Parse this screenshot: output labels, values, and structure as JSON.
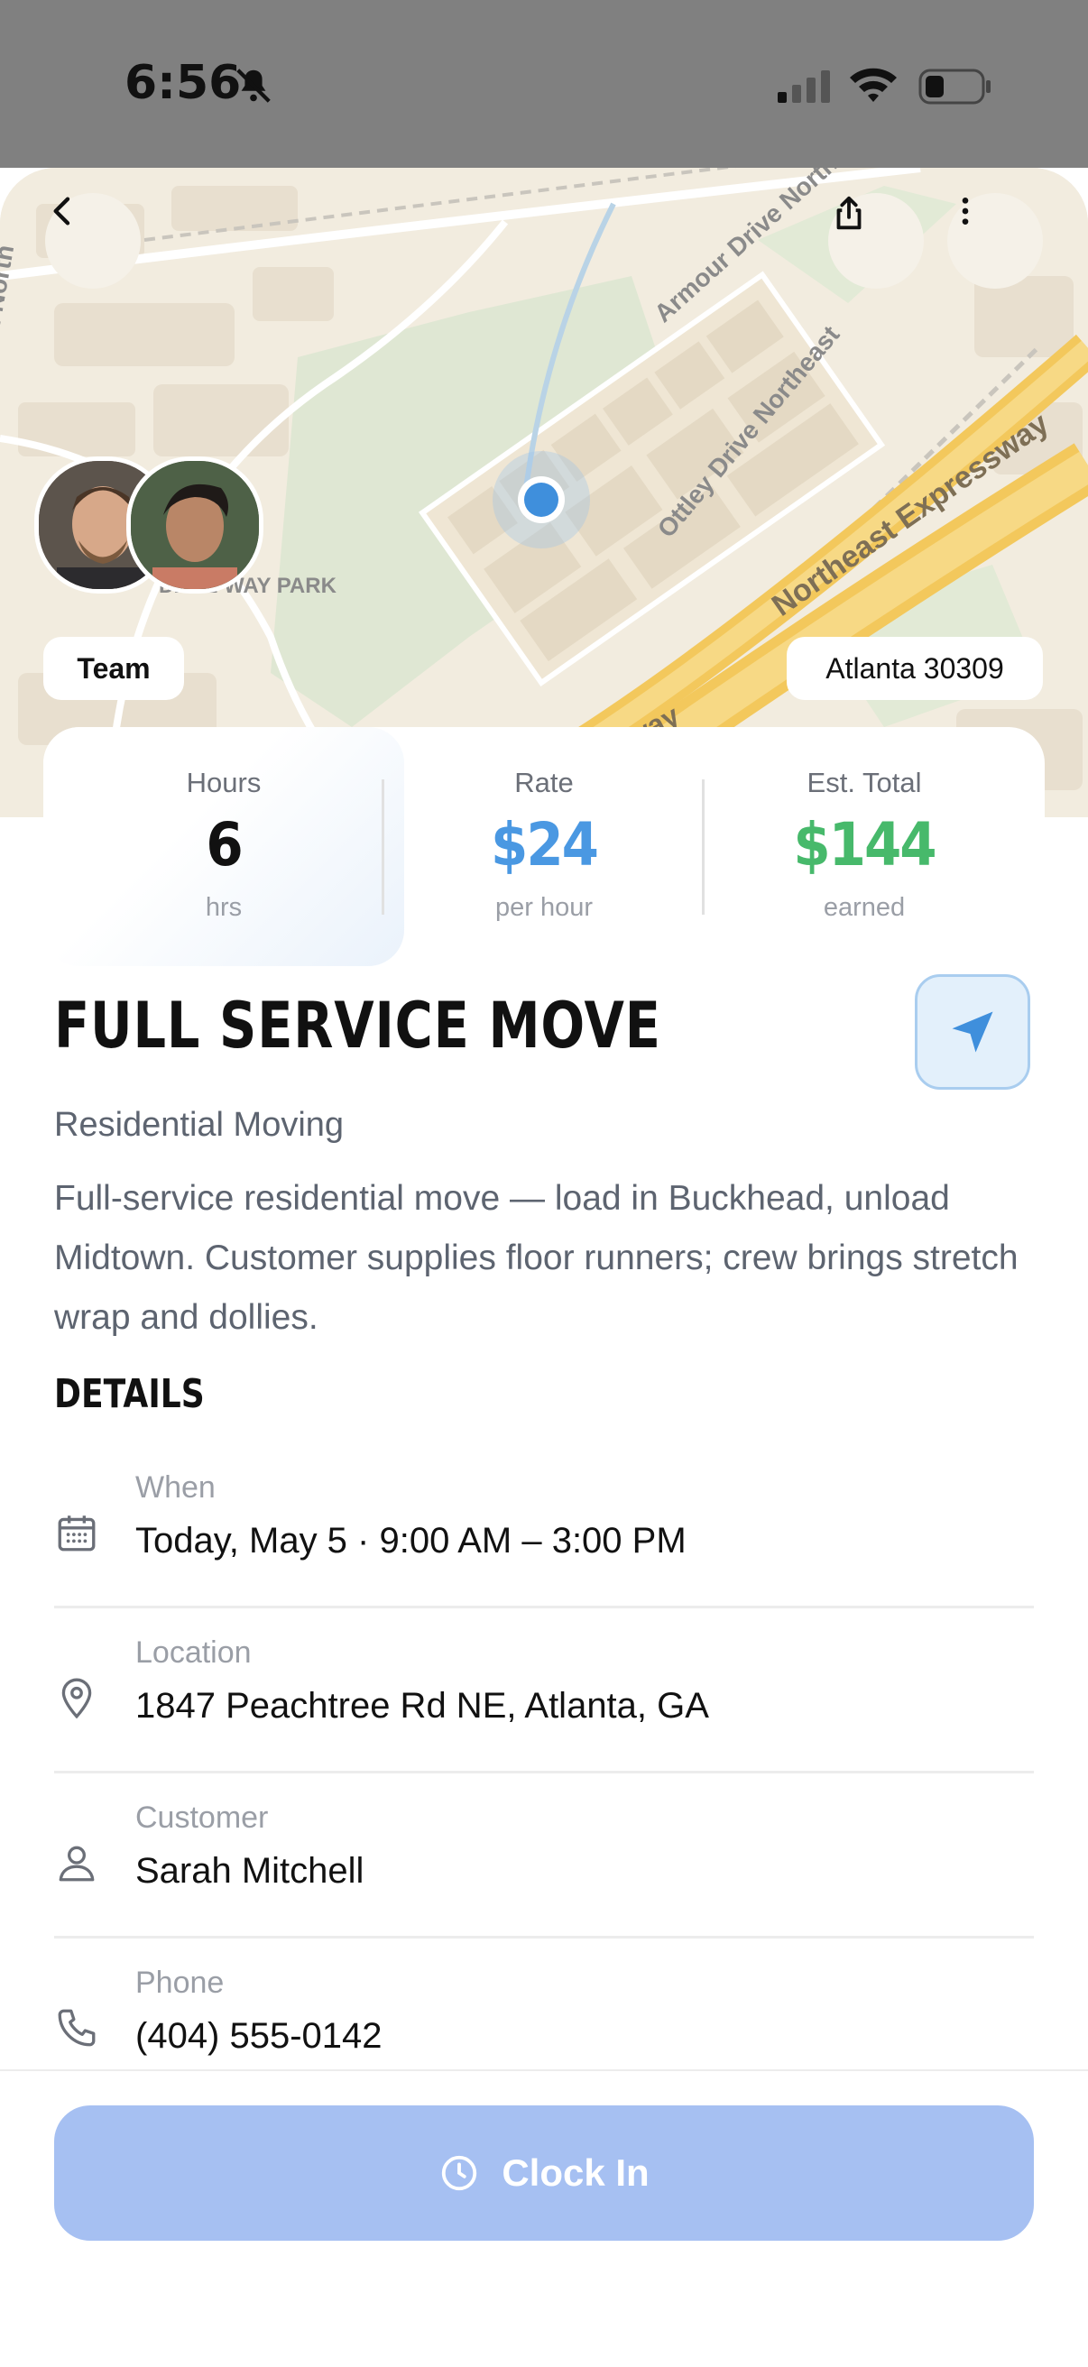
{
  "status_bar": {
    "time": "6:56"
  },
  "map": {
    "labels": {
      "armour": "Armour Drive Northeast",
      "ottley": "Ottley Drive Northeast",
      "expressway": "Northeast Expressway",
      "park": "DALE WAY PARK",
      "road_north": "Road North",
      "essway": "essway"
    },
    "team_label": "Team",
    "location_label": "Atlanta 30309"
  },
  "stats": {
    "hours": {
      "label": "Hours",
      "value": "6",
      "sub": "hrs"
    },
    "rate": {
      "label": "Rate",
      "value": "$24",
      "sub": "per hour"
    },
    "total": {
      "label": "Est. Total",
      "value": "$144",
      "sub": "earned"
    }
  },
  "job": {
    "title": "FULL SERVICE MOVE",
    "category": "Residential Moving",
    "description": "Full-service residential move — load in Buckhead, unload Midtown. Customer supplies floor runners; crew brings stretch wrap and dollies."
  },
  "details": {
    "heading": "DETAILS",
    "rows": [
      {
        "label": "When",
        "value": "Today, May 5 · 9:00 AM – 3:00 PM",
        "icon": "calendar-icon"
      },
      {
        "label": "Location",
        "value": "1847 Peachtree Rd NE, Atlanta, GA",
        "icon": "map-pin-icon"
      },
      {
        "label": "Customer",
        "value": "Sarah Mitchell",
        "icon": "person-icon"
      },
      {
        "label": "Phone",
        "value": "(404) 555-0142",
        "icon": "phone-icon"
      }
    ]
  },
  "footer": {
    "clock_in_label": "Clock In"
  },
  "colors": {
    "rate": "#4a98e2",
    "total": "#47b96b",
    "clock_in_bg": "#a6c0f2",
    "nav_accent": "#3f8fdc"
  }
}
